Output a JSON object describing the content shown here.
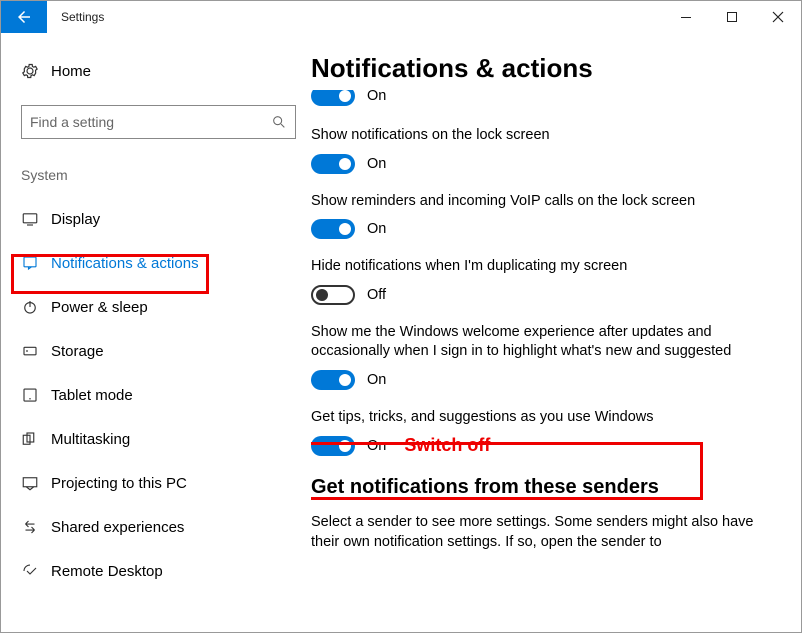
{
  "window": {
    "title": "Settings",
    "min": "—",
    "max": "▢",
    "close": "✕"
  },
  "sidebar": {
    "home": "Home",
    "search_placeholder": "Find a setting",
    "category": "System",
    "items": [
      {
        "label": "Display"
      },
      {
        "label": "Notifications & actions"
      },
      {
        "label": "Power & sleep"
      },
      {
        "label": "Storage"
      },
      {
        "label": "Tablet mode"
      },
      {
        "label": "Multitasking"
      },
      {
        "label": "Projecting to this PC"
      },
      {
        "label": "Shared experiences"
      },
      {
        "label": "Remote Desktop"
      }
    ]
  },
  "main": {
    "title": "Notifications & actions",
    "settings": [
      {
        "label": "",
        "state": "On",
        "on": true,
        "cut": true
      },
      {
        "label": "Show notifications on the lock screen",
        "state": "On",
        "on": true
      },
      {
        "label": "Show reminders and incoming VoIP calls on the lock screen",
        "state": "On",
        "on": true
      },
      {
        "label": "Hide notifications when I'm duplicating my screen",
        "state": "Off",
        "on": false
      },
      {
        "label": "Show me the Windows welcome experience after updates and occasionally when I sign in to highlight what's new and suggested",
        "state": "On",
        "on": true
      },
      {
        "label": "Get tips, tricks, and suggestions as you use Windows",
        "state": "On",
        "on": true,
        "highlight": true
      }
    ],
    "annotation": "Switch off",
    "subheading": "Get notifications from these senders",
    "subdesc": "Select a sender to see more settings. Some senders might also have their own notification settings. If so, open the sender to"
  }
}
